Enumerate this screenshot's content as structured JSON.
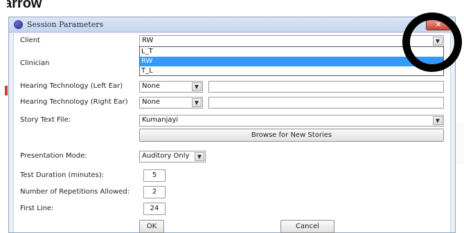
{
  "heading_fragment": "arrow",
  "dialog": {
    "title": "Session Parameters",
    "close_symbol": "✕"
  },
  "form": {
    "client": {
      "label": "Client",
      "value": "RW",
      "options": [
        "L_T",
        "RW",
        "T_L"
      ],
      "selected_option": "RW"
    },
    "clinician": {
      "label": "Clinician"
    },
    "ht_left": {
      "label": "Hearing Technology (Left Ear)",
      "value": "None"
    },
    "ht_right": {
      "label": "Hearing Technology (Right Ear)",
      "value": "None"
    },
    "story_file": {
      "label": "Story Text File:",
      "value": "Kumanjayi"
    },
    "browse_label": "Browse for New Stories",
    "presentation": {
      "label": "Presentation Mode:",
      "value": "Auditory Only"
    },
    "duration": {
      "label": "Test Duration (minutes):",
      "value": "5"
    },
    "repetitions": {
      "label": "Number of Repetitions Allowed:",
      "value": "2"
    },
    "first_line": {
      "label": "First Line:",
      "value": "24"
    },
    "ok_label": "OK",
    "cancel_label": "Cancel"
  },
  "icons": {
    "app": "app-icon",
    "close": "close-icon",
    "dropdown": "chevron-down-icon"
  },
  "colors": {
    "selection": "#3399ff",
    "close_button": "#c54634",
    "annotation_ring": "#000000"
  }
}
